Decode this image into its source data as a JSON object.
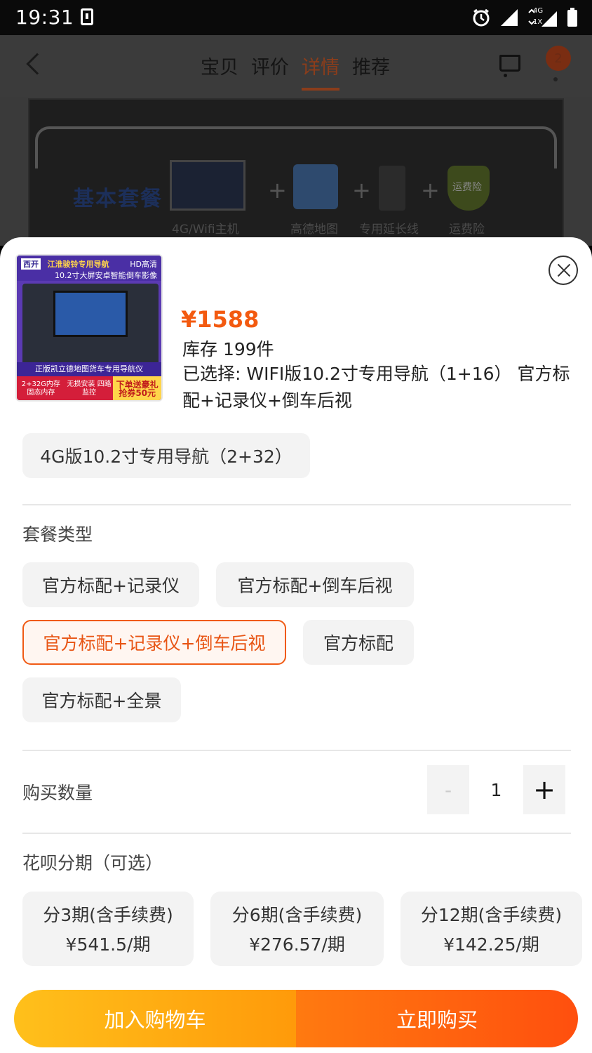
{
  "status_bar": {
    "time": "19:31",
    "network_top": "4G",
    "network_bottom": "1X"
  },
  "nav": {
    "tabs": [
      {
        "label": "宝贝"
      },
      {
        "label": "评价"
      },
      {
        "label": "详情",
        "active": true
      },
      {
        "label": "推荐"
      }
    ],
    "cart_badge": "2"
  },
  "banner": {
    "title": "基本套餐",
    "items": [
      "4G/Wifi主机",
      "高德地图",
      "专用延长线",
      "运费险"
    ],
    "shield_label": "运费险"
  },
  "product": {
    "thumb": {
      "brand": "西开",
      "headline": "江淮骏铃专用导航",
      "sub": "10.2寸大屏安卓智能",
      "tag": "HD高清",
      "tag2": "倒车影像",
      "caption": "正版凯立德地图货车专用导航仪",
      "foot1": "2+32G内存 固态内存",
      "foot2": "无损安装 四路监控",
      "promo": "下单送豪礼 抢券50元"
    },
    "price": "¥1588",
    "stock": "库存 199件",
    "selected": "已选择: WIFI版10.2寸专用导航（1+16） 官方标配+记录仪+倒车后视"
  },
  "version_option": "4G版10.2寸专用导航（2+32）",
  "package": {
    "title": "套餐类型",
    "options": [
      {
        "label": "官方标配+记录仪"
      },
      {
        "label": "官方标配+倒车后视"
      },
      {
        "label": "官方标配+记录仪+倒车后视",
        "selected": true
      },
      {
        "label": "官方标配"
      },
      {
        "label": "官方标配+全景"
      }
    ]
  },
  "quantity": {
    "title": "购买数量",
    "minus": "-",
    "value": "1",
    "plus": "+"
  },
  "installment": {
    "title": "花呗分期（可选）",
    "options": [
      {
        "label": "分3期(含手续费)",
        "amount": "¥541.5/期"
      },
      {
        "label": "分6期(含手续费)",
        "amount": "¥276.57/期"
      },
      {
        "label": "分12期(含手续费)",
        "amount": "¥142.25/期"
      }
    ]
  },
  "actions": {
    "add_to_cart": "加入购物车",
    "buy_now": "立即购买"
  },
  "colors": {
    "accent": "#f35a10",
    "cart_btn": "#ffa50e",
    "buy_btn": "#ff5a0f"
  }
}
